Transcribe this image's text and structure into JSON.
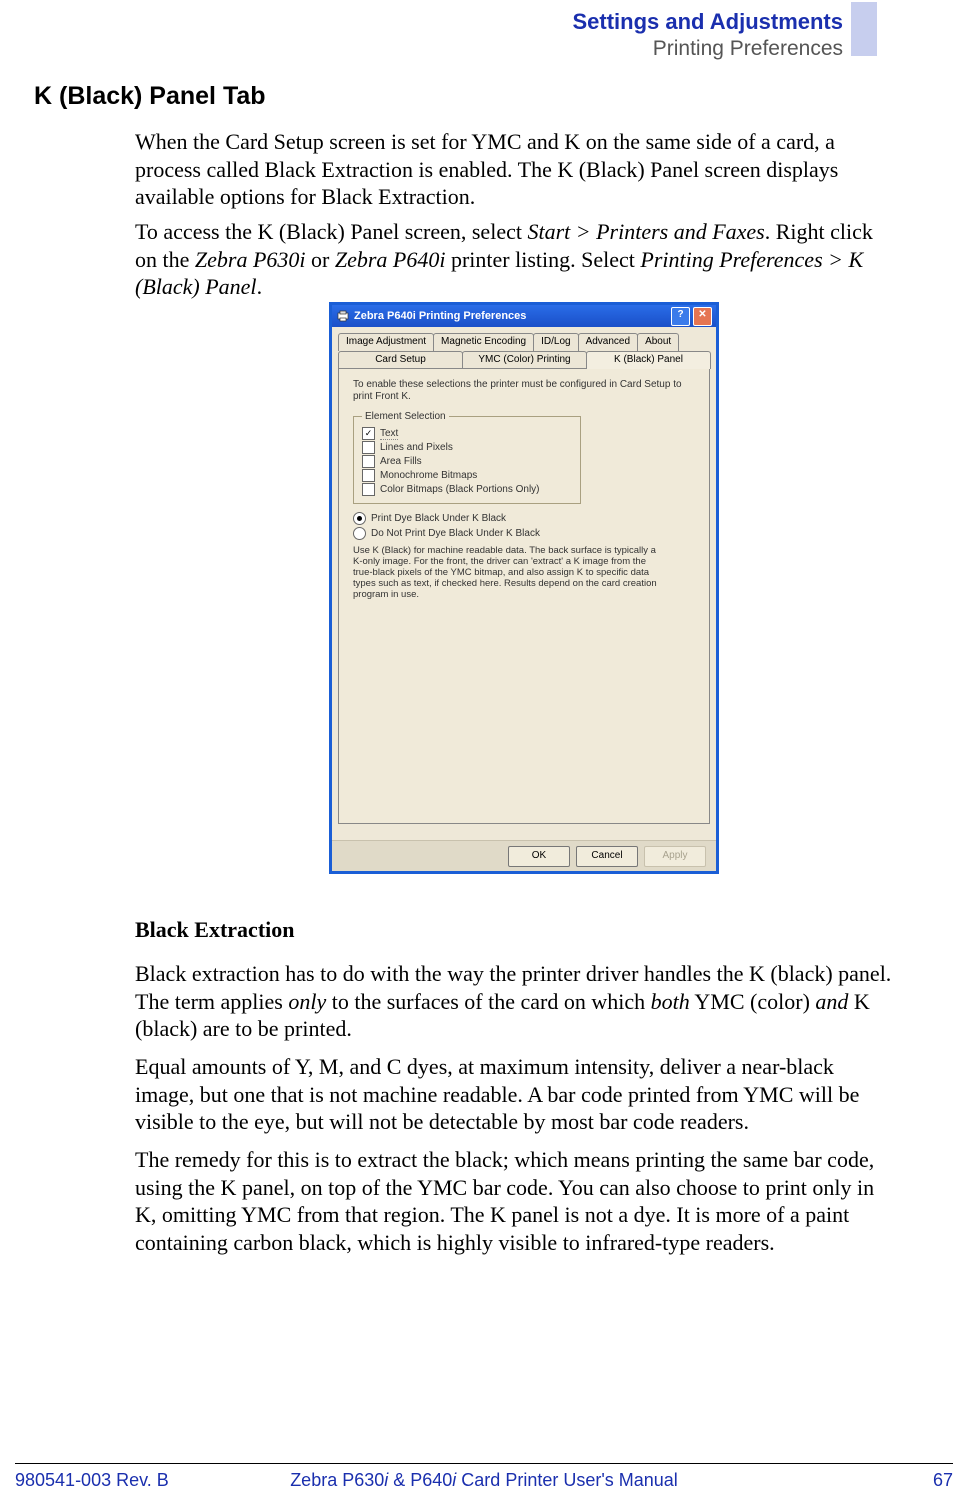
{
  "header": {
    "title": "Settings and Adjustments",
    "subtitle": "Printing Preferences"
  },
  "section_title": "K (Black) Panel Tab",
  "intro_p1": "When the Card Setup screen is set for YMC and K on the same side of a card, a process called Black Extraction is enabled. The K (Black) Panel screen displays available options for Black Extraction.",
  "intro_p2a": "To access the K (Black) Panel screen, select ",
  "intro_p2b": "Start > Printers and Faxes",
  "intro_p2c": ". Right click on the ",
  "intro_p2d": "Zebra P630i",
  "intro_p2e": " or ",
  "intro_p2f": "Zebra P640i",
  "intro_p2g": " printer listing. Select ",
  "intro_p2h": "Printing Preferences > K (Black) Panel",
  "intro_p2i": ".",
  "dialog": {
    "title": "Zebra P640i Printing Preferences",
    "tabs_row1": [
      "Image Adjustment",
      "Magnetic Encoding",
      "ID/Log",
      "Advanced",
      "About"
    ],
    "tabs_row2": [
      "Card Setup",
      "YMC (Color) Printing",
      "K (Black) Panel"
    ],
    "active_tab": "K (Black) Panel",
    "panel": {
      "instruction": "To enable these selections the printer must be configured in Card Setup to print Front K.",
      "element_selection": {
        "legend": "Element Selection",
        "items": [
          {
            "label": "Text",
            "checked": true
          },
          {
            "label": "Lines and Pixels",
            "checked": false
          },
          {
            "label": "Area Fills",
            "checked": false
          },
          {
            "label": "Monochrome Bitmaps",
            "checked": false
          },
          {
            "label": "Color Bitmaps (Black Portions Only)",
            "checked": false
          }
        ]
      },
      "radios": [
        {
          "label": "Print Dye Black Under K Black",
          "checked": true
        },
        {
          "label": "Do Not Print Dye Black Under K Black",
          "checked": false
        }
      ],
      "help1": "Use K (Black) for machine readable data. The back surface is typically a K-only image. For the front, the driver can 'extract' a K image from the true-black pixels of the YMC bitmap, and also assign K to specific data types such as text, if checked here. Results depend on the card creation program in use."
    },
    "buttons": {
      "ok": "OK",
      "cancel": "Cancel",
      "apply": "Apply"
    }
  },
  "subheading": "Black Extraction",
  "para1a": "Black extraction has to do with the way the printer driver handles the K (black) panel. The term applies ",
  "para1b": "only",
  "para1c": " to the surfaces of the card on which ",
  "para1d": "both",
  "para1e": " YMC (color) ",
  "para1f": "and",
  "para1g": " K (black) are to be printed.",
  "para2": "Equal amounts of Y, M, and C dyes, at maximum intensity, deliver a near-black image, but one that is not machine readable. A bar code printed from YMC will be visible to the eye, but will not be detectable by most bar code readers.",
  "para3": "The remedy for this is to extract the black; which means printing the same bar code, using the K panel, on top of the YMC bar code. You can also choose to print only in K, omitting YMC from that region. The K panel is not a dye. It is more of a paint containing carbon black, which is highly visible to infrared-type readers.",
  "footer": {
    "left": "980541-003 Rev. B",
    "center_a": "Zebra P630",
    "center_b": "i",
    "center_c": " & P640",
    "center_d": "i",
    "center_e": " Card Printer User's Manual",
    "right": "67"
  }
}
